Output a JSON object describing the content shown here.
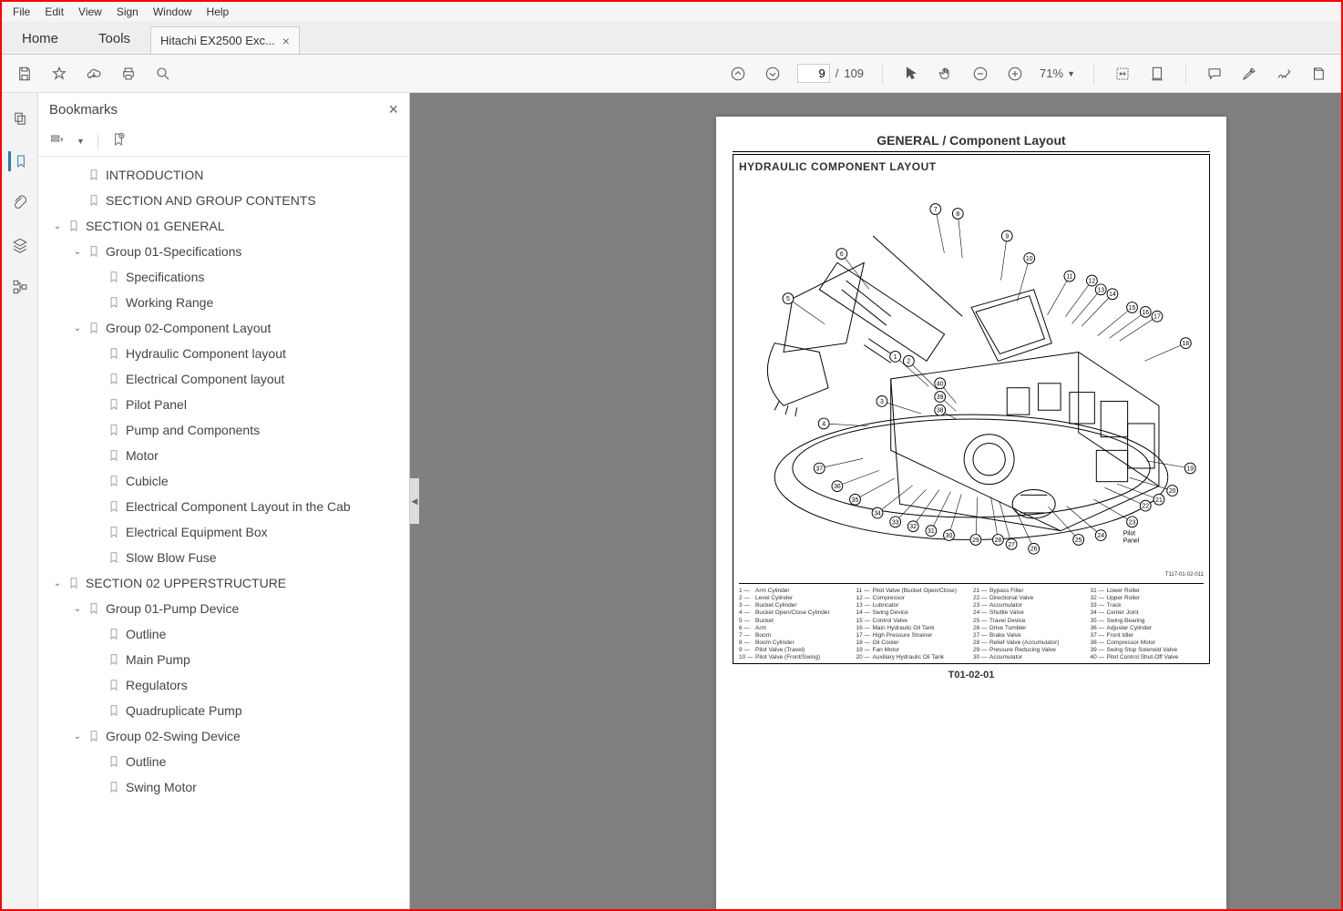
{
  "menu": [
    "File",
    "Edit",
    "View",
    "Sign",
    "Window",
    "Help"
  ],
  "viewTabs": {
    "home": "Home",
    "tools": "Tools"
  },
  "docTab": "Hitachi EX2500 Exc...",
  "pageNav": {
    "current": "9",
    "sep": "/",
    "total": "109"
  },
  "zoom": "71%",
  "sidepanel": {
    "title": "Bookmarks"
  },
  "bookmarks": [
    {
      "depth": 1,
      "twisty": "",
      "label": "INTRODUCTION"
    },
    {
      "depth": 1,
      "twisty": "",
      "label": "SECTION AND GROUP CONTENTS"
    },
    {
      "depth": 0,
      "twisty": "v",
      "label": "SECTION 01 GENERAL"
    },
    {
      "depth": 1,
      "twisty": "v",
      "label": "Group 01-Specifications"
    },
    {
      "depth": 2,
      "twisty": "",
      "label": "Specifications"
    },
    {
      "depth": 2,
      "twisty": "",
      "label": "Working Range"
    },
    {
      "depth": 1,
      "twisty": "v",
      "label": "Group 02-Component Layout"
    },
    {
      "depth": 2,
      "twisty": "",
      "label": "Hydraulic Component layout"
    },
    {
      "depth": 2,
      "twisty": "",
      "label": "Electrical Component layout"
    },
    {
      "depth": 2,
      "twisty": "",
      "label": "Pilot Panel"
    },
    {
      "depth": 2,
      "twisty": "",
      "label": "Pump and Components"
    },
    {
      "depth": 2,
      "twisty": "",
      "label": "Motor"
    },
    {
      "depth": 2,
      "twisty": "",
      "label": "Cubicle"
    },
    {
      "depth": 2,
      "twisty": "",
      "label": "Electrical Component Layout in the Cab"
    },
    {
      "depth": 2,
      "twisty": "",
      "label": "Electrical Equipment Box"
    },
    {
      "depth": 2,
      "twisty": "",
      "label": "Slow Blow Fuse"
    },
    {
      "depth": 0,
      "twisty": "v",
      "label": "SECTION 02 UPPERSTRUCTURE"
    },
    {
      "depth": 1,
      "twisty": "v",
      "label": "Group 01-Pump Device"
    },
    {
      "depth": 2,
      "twisty": "",
      "label": "Outline"
    },
    {
      "depth": 2,
      "twisty": "",
      "label": "Main Pump"
    },
    {
      "depth": 2,
      "twisty": "",
      "label": "Regulators"
    },
    {
      "depth": 2,
      "twisty": "",
      "label": "Quadruplicate Pump"
    },
    {
      "depth": 1,
      "twisty": "v",
      "label": "Group 02-Swing Device"
    },
    {
      "depth": 2,
      "twisty": "",
      "label": "Outline"
    },
    {
      "depth": 2,
      "twisty": "",
      "label": "Swing Motor"
    }
  ],
  "doc": {
    "title": "GENERAL / Component Layout",
    "subhead": "HYDRAULIC COMPONENT LAYOUT",
    "figref": "T117-01-02-011",
    "footer": "T01-02-01",
    "pilotPanel": "Pilot\nPanel",
    "legendCols": [
      [
        {
          "n": "1",
          "t": "Arm Cylinder"
        },
        {
          "n": "2",
          "t": "Level Cylinder"
        },
        {
          "n": "3",
          "t": "Bucket Cylinder"
        },
        {
          "n": "4",
          "t": "Bucket Open/Close Cylinder"
        },
        {
          "n": "5",
          "t": "Bucket"
        },
        {
          "n": "6",
          "t": "Arm"
        },
        {
          "n": "7",
          "t": "Boom"
        },
        {
          "n": "8",
          "t": "Boom Cylinder"
        },
        {
          "n": "9",
          "t": "Pilot Valve (Travel)"
        },
        {
          "n": "10",
          "t": "Pilot Valve (Front/Swing)"
        }
      ],
      [
        {
          "n": "11",
          "t": "Pilot Valve (Bucket Open/Close)"
        },
        {
          "n": "12",
          "t": "Compressor"
        },
        {
          "n": "13",
          "t": "Lubricator"
        },
        {
          "n": "14",
          "t": "Swing Device"
        },
        {
          "n": "15",
          "t": "Control Valve"
        },
        {
          "n": "16",
          "t": "Main Hydraulic Oil Tank"
        },
        {
          "n": "17",
          "t": "High Pressure Strainer"
        },
        {
          "n": "18",
          "t": "Oil Cooler"
        },
        {
          "n": "19",
          "t": "Fan Motor"
        },
        {
          "n": "20",
          "t": "Auxiliary Hydraulic Oil Tank"
        }
      ],
      [
        {
          "n": "21",
          "t": "Bypass Filter"
        },
        {
          "n": "22",
          "t": "Directional Valve"
        },
        {
          "n": "23",
          "t": "Accumulator"
        },
        {
          "n": "24",
          "t": "Shuttle Valve"
        },
        {
          "n": "25",
          "t": "Travel Device"
        },
        {
          "n": "26",
          "t": "Drive Tumbler"
        },
        {
          "n": "27",
          "t": "Brake Valve"
        },
        {
          "n": "28",
          "t": "Relief Valve (Accumulator)"
        },
        {
          "n": "29",
          "t": "Pressure Reducing Valve"
        },
        {
          "n": "30",
          "t": "Accumulator"
        }
      ],
      [
        {
          "n": "31",
          "t": "Lower Roller"
        },
        {
          "n": "32",
          "t": "Upper Roller"
        },
        {
          "n": "33",
          "t": "Track"
        },
        {
          "n": "34",
          "t": "Center Joint"
        },
        {
          "n": "35",
          "t": "Swing Bearing"
        },
        {
          "n": "36",
          "t": "Adjuster Cylinder"
        },
        {
          "n": "37",
          "t": "Front Idler"
        },
        {
          "n": "38",
          "t": "Compressor Motor"
        },
        {
          "n": "39",
          "t": "Swing Stop Solenoid Valve"
        },
        {
          "n": "40",
          "t": "Pilot Control Shut-Off Valve"
        }
      ]
    ]
  }
}
